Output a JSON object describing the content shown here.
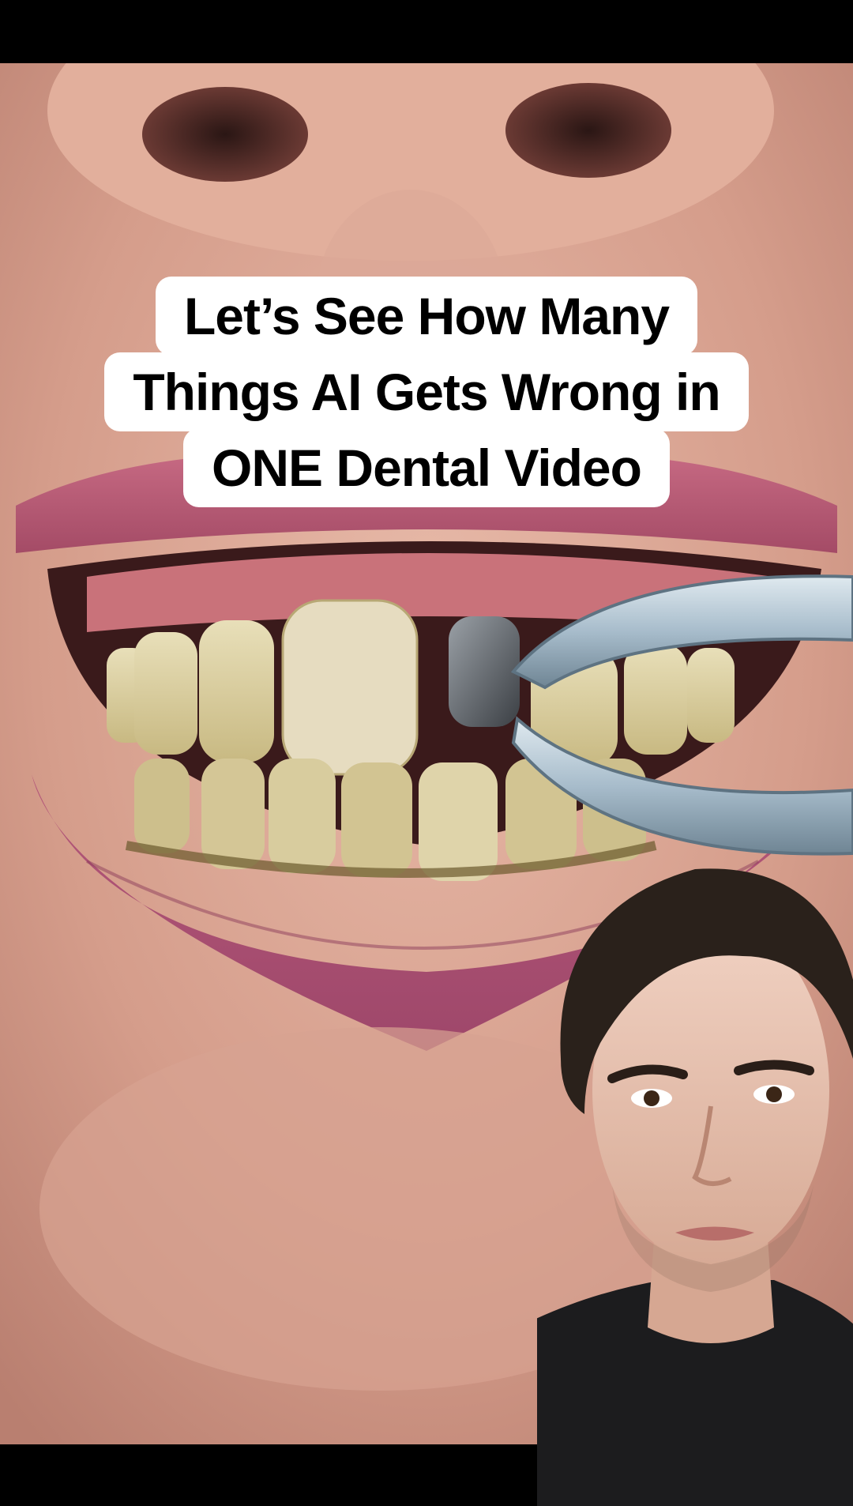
{
  "overlay": {
    "caption_lines": [
      "Let’s See How Many",
      "Things AI Gets Wrong in",
      "ONE Dental Video"
    ]
  },
  "scene": {
    "main_video": "close-up of mouth with stained teeth, dark metal tooth, and dental forceps",
    "picture_in_picture": "dentist presenter in dark scrubs"
  },
  "colors": {
    "caption_bg": "#ffffff",
    "caption_text": "#000000",
    "skin": "#d9a593",
    "lips": "#b4566f",
    "gums": "#c9727a",
    "teeth": "#d8cc9a",
    "forceps": "#9fb6c4",
    "scrubs": "#1c1c1e",
    "hair": "#2a211b"
  }
}
